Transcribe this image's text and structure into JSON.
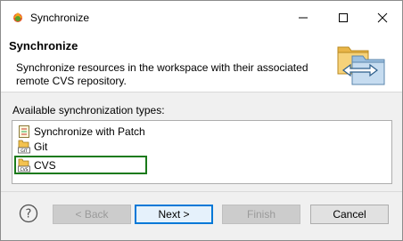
{
  "window": {
    "title": "Synchronize",
    "controls": {
      "minimize": "minimize",
      "maximize": "maximize",
      "close": "close"
    }
  },
  "banner": {
    "title": "Synchronize",
    "description": "Synchronize resources in the workspace with their associated remote CVS repository."
  },
  "types": {
    "label": "Available synchronization types:",
    "items": [
      {
        "label": "Synchronize with Patch",
        "icon": "patch-icon"
      },
      {
        "label": "Git",
        "icon": "git-icon"
      },
      {
        "label": "CVS",
        "icon": "cvs-icon",
        "selected": true
      }
    ]
  },
  "buttons": {
    "help": "?",
    "back": "< Back",
    "next": "Next >",
    "finish": "Finish",
    "cancel": "Cancel"
  },
  "colors": {
    "selection_outline": "#1a7a1a",
    "default_button_border": "#0078d7"
  }
}
